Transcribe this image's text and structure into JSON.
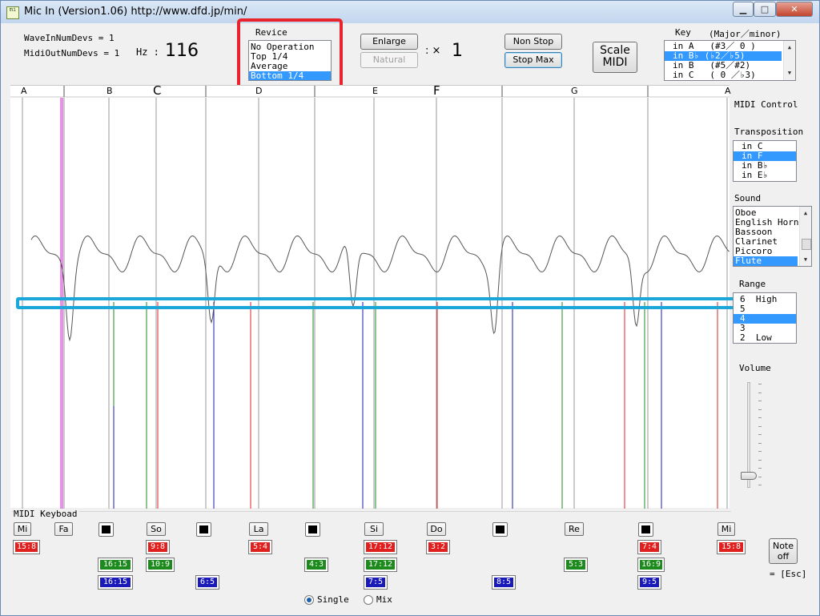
{
  "window": {
    "title": "Mic In (Version1.06)    http://www.dfd.jp/min/",
    "icon_name": "app-icon",
    "icon_text": "mi"
  },
  "info": {
    "wave_in": "WaveInNumDevs = 1",
    "midi_out": "MidiOutNumDevs = 1",
    "hz_label": "Hz :",
    "hz_value": "116"
  },
  "revice": {
    "label": "Revice",
    "options": [
      "No Operation",
      "Top 1/4",
      "Average",
      "Bottom 1/4"
    ],
    "selected": "Bottom 1/4"
  },
  "zoom": {
    "enlarge_label": "Enlarge",
    "natural_label": "Natural",
    "times_label": ": ×",
    "factor": "1"
  },
  "controls": {
    "non_stop_label": "Non Stop",
    "stop_max_label": "Stop Max",
    "scale_label": "Scale",
    "midi_label": "MIDI"
  },
  "key": {
    "label": "Key",
    "sub_label": "(Major／minor)",
    "options": [
      "in A   (#3／ 0 )",
      "in B♭ (♭2／♭5)",
      "in B   (#5／#2)",
      "in C   ( 0 ／♭3)"
    ],
    "selected": "in B♭ (♭2／♭5)"
  },
  "plot": {
    "note_headers": [
      {
        "name": "A"
      },
      {
        "name": "B"
      },
      {
        "name": "C"
      },
      {
        "name": "D"
      },
      {
        "name": "E"
      },
      {
        "name": "F"
      },
      {
        "name": "G"
      },
      {
        "name": "A"
      }
    ]
  },
  "midi_control": {
    "label": "MIDI Control",
    "transposition": {
      "label": "Transposition",
      "options": [
        "in C",
        "in F",
        "in B♭",
        "in E♭"
      ],
      "selected": "in F"
    },
    "sound": {
      "label": "Sound",
      "options": [
        "Oboe",
        "English Horn",
        "Bassoon",
        "Clarinet",
        "Piccoro",
        "Flute"
      ],
      "selected": "Flute"
    },
    "range": {
      "label": "Range",
      "options": [
        "6  High",
        "5",
        "4",
        "3",
        "2  Low"
      ],
      "selected": "4"
    },
    "volume": {
      "label": "Volume",
      "level": 0.1
    }
  },
  "keyboard": {
    "label": "MIDI Keyboad",
    "keys": [
      "Mi",
      "Fa",
      "So",
      "La",
      "Si",
      "Do",
      "Re",
      "Mi"
    ],
    "ratios_row1": [
      "15:8",
      "9:8",
      "5:4",
      "17:12",
      "3:2",
      "7:4",
      "15:8"
    ],
    "ratios_row2": [
      "16:15",
      "10:9",
      "4:3",
      "17:12",
      "5:3",
      "16:9"
    ],
    "ratios_row3": [
      "16:15",
      "6:5",
      "7:5",
      "8:5",
      "9:5"
    ],
    "note_off_label": "Note off",
    "esc_label": "= [Esc]",
    "mode_single": "Single",
    "mode_mix": "Mix",
    "mode_selected": "Single"
  },
  "colors": {
    "highlight_red": "#e8232b",
    "highlight_cyan": "#1ba7d9",
    "list_selection": "#3399ff",
    "line_red": "#e02020",
    "line_green": "#1c8a1c",
    "line_blue": "#1a1ab8",
    "line_magenta": "#d020d0"
  }
}
